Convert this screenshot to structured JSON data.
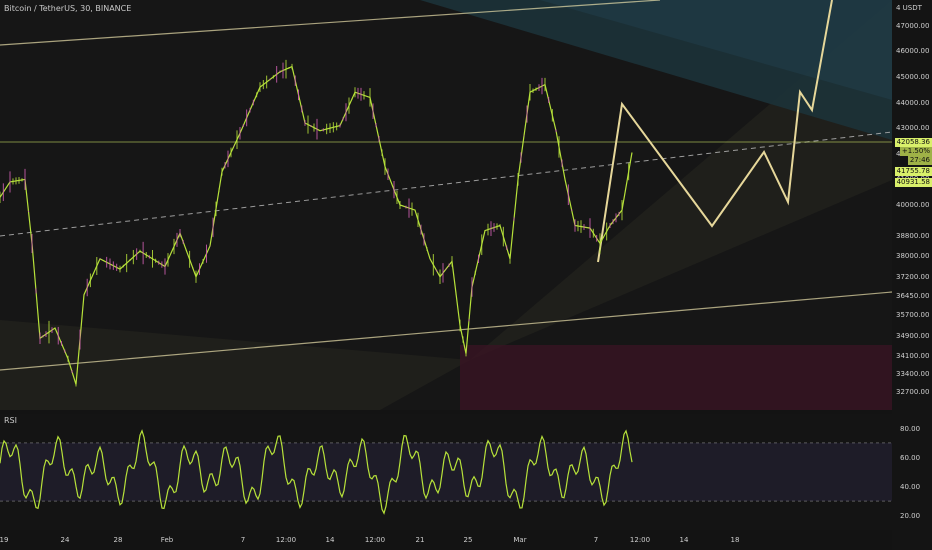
{
  "header": {
    "title": "Bitcoin / TetherUS, 30, BINANCE",
    "rsi_label": "RSI",
    "currency": "USDT"
  },
  "price_tags": [
    {
      "value": "42058.36",
      "style": "main"
    },
    {
      "value": "+1.50%",
      "style": "muted"
    },
    {
      "value": "27:46",
      "style": "muted"
    },
    {
      "value": "41755.78",
      "style": "main"
    },
    {
      "value": "40931.58",
      "style": "main"
    }
  ],
  "chart_data": [
    {
      "type": "line",
      "name": "price",
      "x_labels": [
        "19",
        "24",
        "28",
        "Feb",
        "7",
        "12:00",
        "14",
        "12:00",
        "21",
        "25",
        "Mar",
        "7",
        "12:00",
        "14",
        "18"
      ],
      "y_axis_ticks": [
        32700,
        33400,
        34100,
        34900,
        35700,
        36450,
        37200,
        38000,
        38800,
        40000,
        41000,
        42000,
        43000,
        44000,
        45000,
        46000,
        47000
      ],
      "ylim": [
        32000,
        48000
      ],
      "current_price": 42058.36,
      "approx_path": [
        [
          0,
          40300
        ],
        [
          10,
          40900
        ],
        [
          25,
          41000
        ],
        [
          32,
          38500
        ],
        [
          40,
          34800
        ],
        [
          55,
          35200
        ],
        [
          68,
          34000
        ],
        [
          76,
          33000
        ],
        [
          84,
          36500
        ],
        [
          100,
          37900
        ],
        [
          120,
          37500
        ],
        [
          140,
          38200
        ],
        [
          165,
          37600
        ],
        [
          180,
          38900
        ],
        [
          196,
          37200
        ],
        [
          210,
          38400
        ],
        [
          222,
          41300
        ],
        [
          240,
          42800
        ],
        [
          260,
          44600
        ],
        [
          280,
          45200
        ],
        [
          292,
          45400
        ],
        [
          305,
          43200
        ],
        [
          320,
          42900
        ],
        [
          340,
          43100
        ],
        [
          355,
          44400
        ],
        [
          370,
          44200
        ],
        [
          385,
          41500
        ],
        [
          400,
          40000
        ],
        [
          415,
          39800
        ],
        [
          430,
          37900
        ],
        [
          440,
          37200
        ],
        [
          452,
          37800
        ],
        [
          460,
          35300
        ],
        [
          466,
          34200
        ],
        [
          472,
          36800
        ],
        [
          485,
          39000
        ],
        [
          500,
          39200
        ],
        [
          510,
          37900
        ],
        [
          518,
          41000
        ],
        [
          530,
          44400
        ],
        [
          545,
          44700
        ],
        [
          556,
          42900
        ],
        [
          565,
          41000
        ],
        [
          575,
          39200
        ],
        [
          590,
          39100
        ],
        [
          600,
          38500
        ],
        [
          610,
          39200
        ],
        [
          622,
          39800
        ],
        [
          632,
          42050
        ]
      ]
    },
    {
      "type": "line",
      "name": "RSI",
      "y_axis_ticks": [
        20,
        40,
        60,
        80
      ],
      "ylim": [
        10,
        90
      ],
      "bands": [
        30,
        70
      ]
    }
  ]
}
